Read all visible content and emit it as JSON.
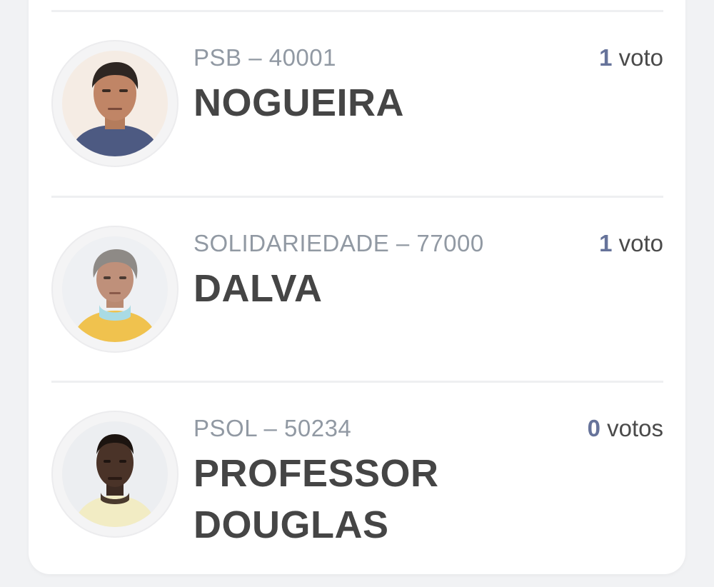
{
  "candidates": [
    {
      "party_number": "PSB – 40001",
      "name_lines": [
        "NOGUEIRA"
      ],
      "vote_count": "1",
      "vote_unit": "voto",
      "avatar_icon": "candidate-photo"
    },
    {
      "party_number": "SOLIDARIEDADE – 77000",
      "name_lines": [
        "DALVA"
      ],
      "vote_count": "1",
      "vote_unit": "voto",
      "avatar_icon": "candidate-photo"
    },
    {
      "party_number": "PSOL – 50234",
      "name_lines": [
        "PROFESSOR",
        "DOUGLAS"
      ],
      "vote_count": "0",
      "vote_unit": "votos",
      "avatar_icon": "candidate-photo"
    }
  ],
  "colors": {
    "party_text": "#9199a3",
    "name_text": "#454545",
    "vote_count": "#66739a",
    "card_bg": "#ffffff",
    "page_bg": "#f1f2f4"
  }
}
